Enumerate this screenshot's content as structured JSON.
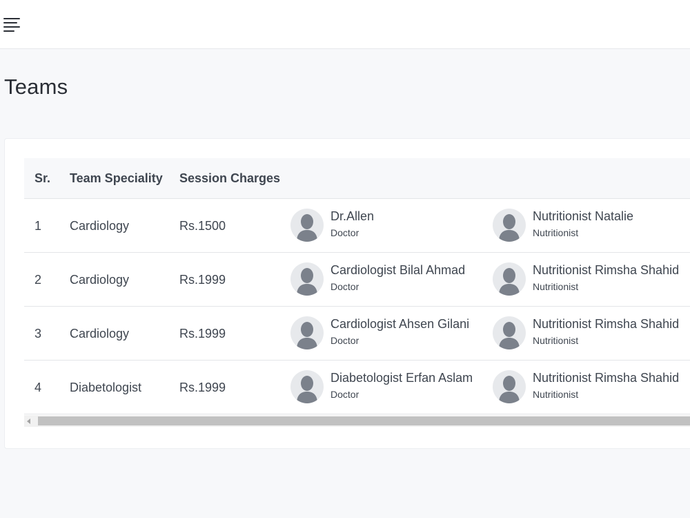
{
  "header": {
    "menu_icon": "hamburger-menu-icon"
  },
  "page": {
    "title": "Teams"
  },
  "table": {
    "columns": [
      "Sr.",
      "Team Speciality",
      "Session Charges"
    ],
    "rows": [
      {
        "sr": "1",
        "speciality": "Cardiology",
        "charges": "Rs.1500",
        "members": [
          {
            "name": "Dr.Allen",
            "role": "Doctor"
          },
          {
            "name": "Nutritionist Natalie",
            "role": "Nutritionist"
          }
        ]
      },
      {
        "sr": "2",
        "speciality": "Cardiology",
        "charges": "Rs.1999",
        "members": [
          {
            "name": "Cardiologist Bilal Ahmad",
            "role": "Doctor"
          },
          {
            "name": "Nutritionist Rimsha Shahid",
            "role": "Nutritionist"
          }
        ]
      },
      {
        "sr": "3",
        "speciality": "Cardiology",
        "charges": "Rs.1999",
        "members": [
          {
            "name": "Cardiologist Ahsen Gilani",
            "role": "Doctor"
          },
          {
            "name": "Nutritionist Rimsha Shahid",
            "role": "Nutritionist"
          }
        ]
      },
      {
        "sr": "4",
        "speciality": "Diabetologist",
        "charges": "Rs.1999",
        "members": [
          {
            "name": "Diabetologist Erfan Aslam",
            "role": "Doctor"
          },
          {
            "name": "Nutritionist Rimsha Shahid",
            "role": "Nutritionist"
          }
        ]
      }
    ]
  },
  "icons": {
    "avatar": "user-avatar-icon"
  }
}
